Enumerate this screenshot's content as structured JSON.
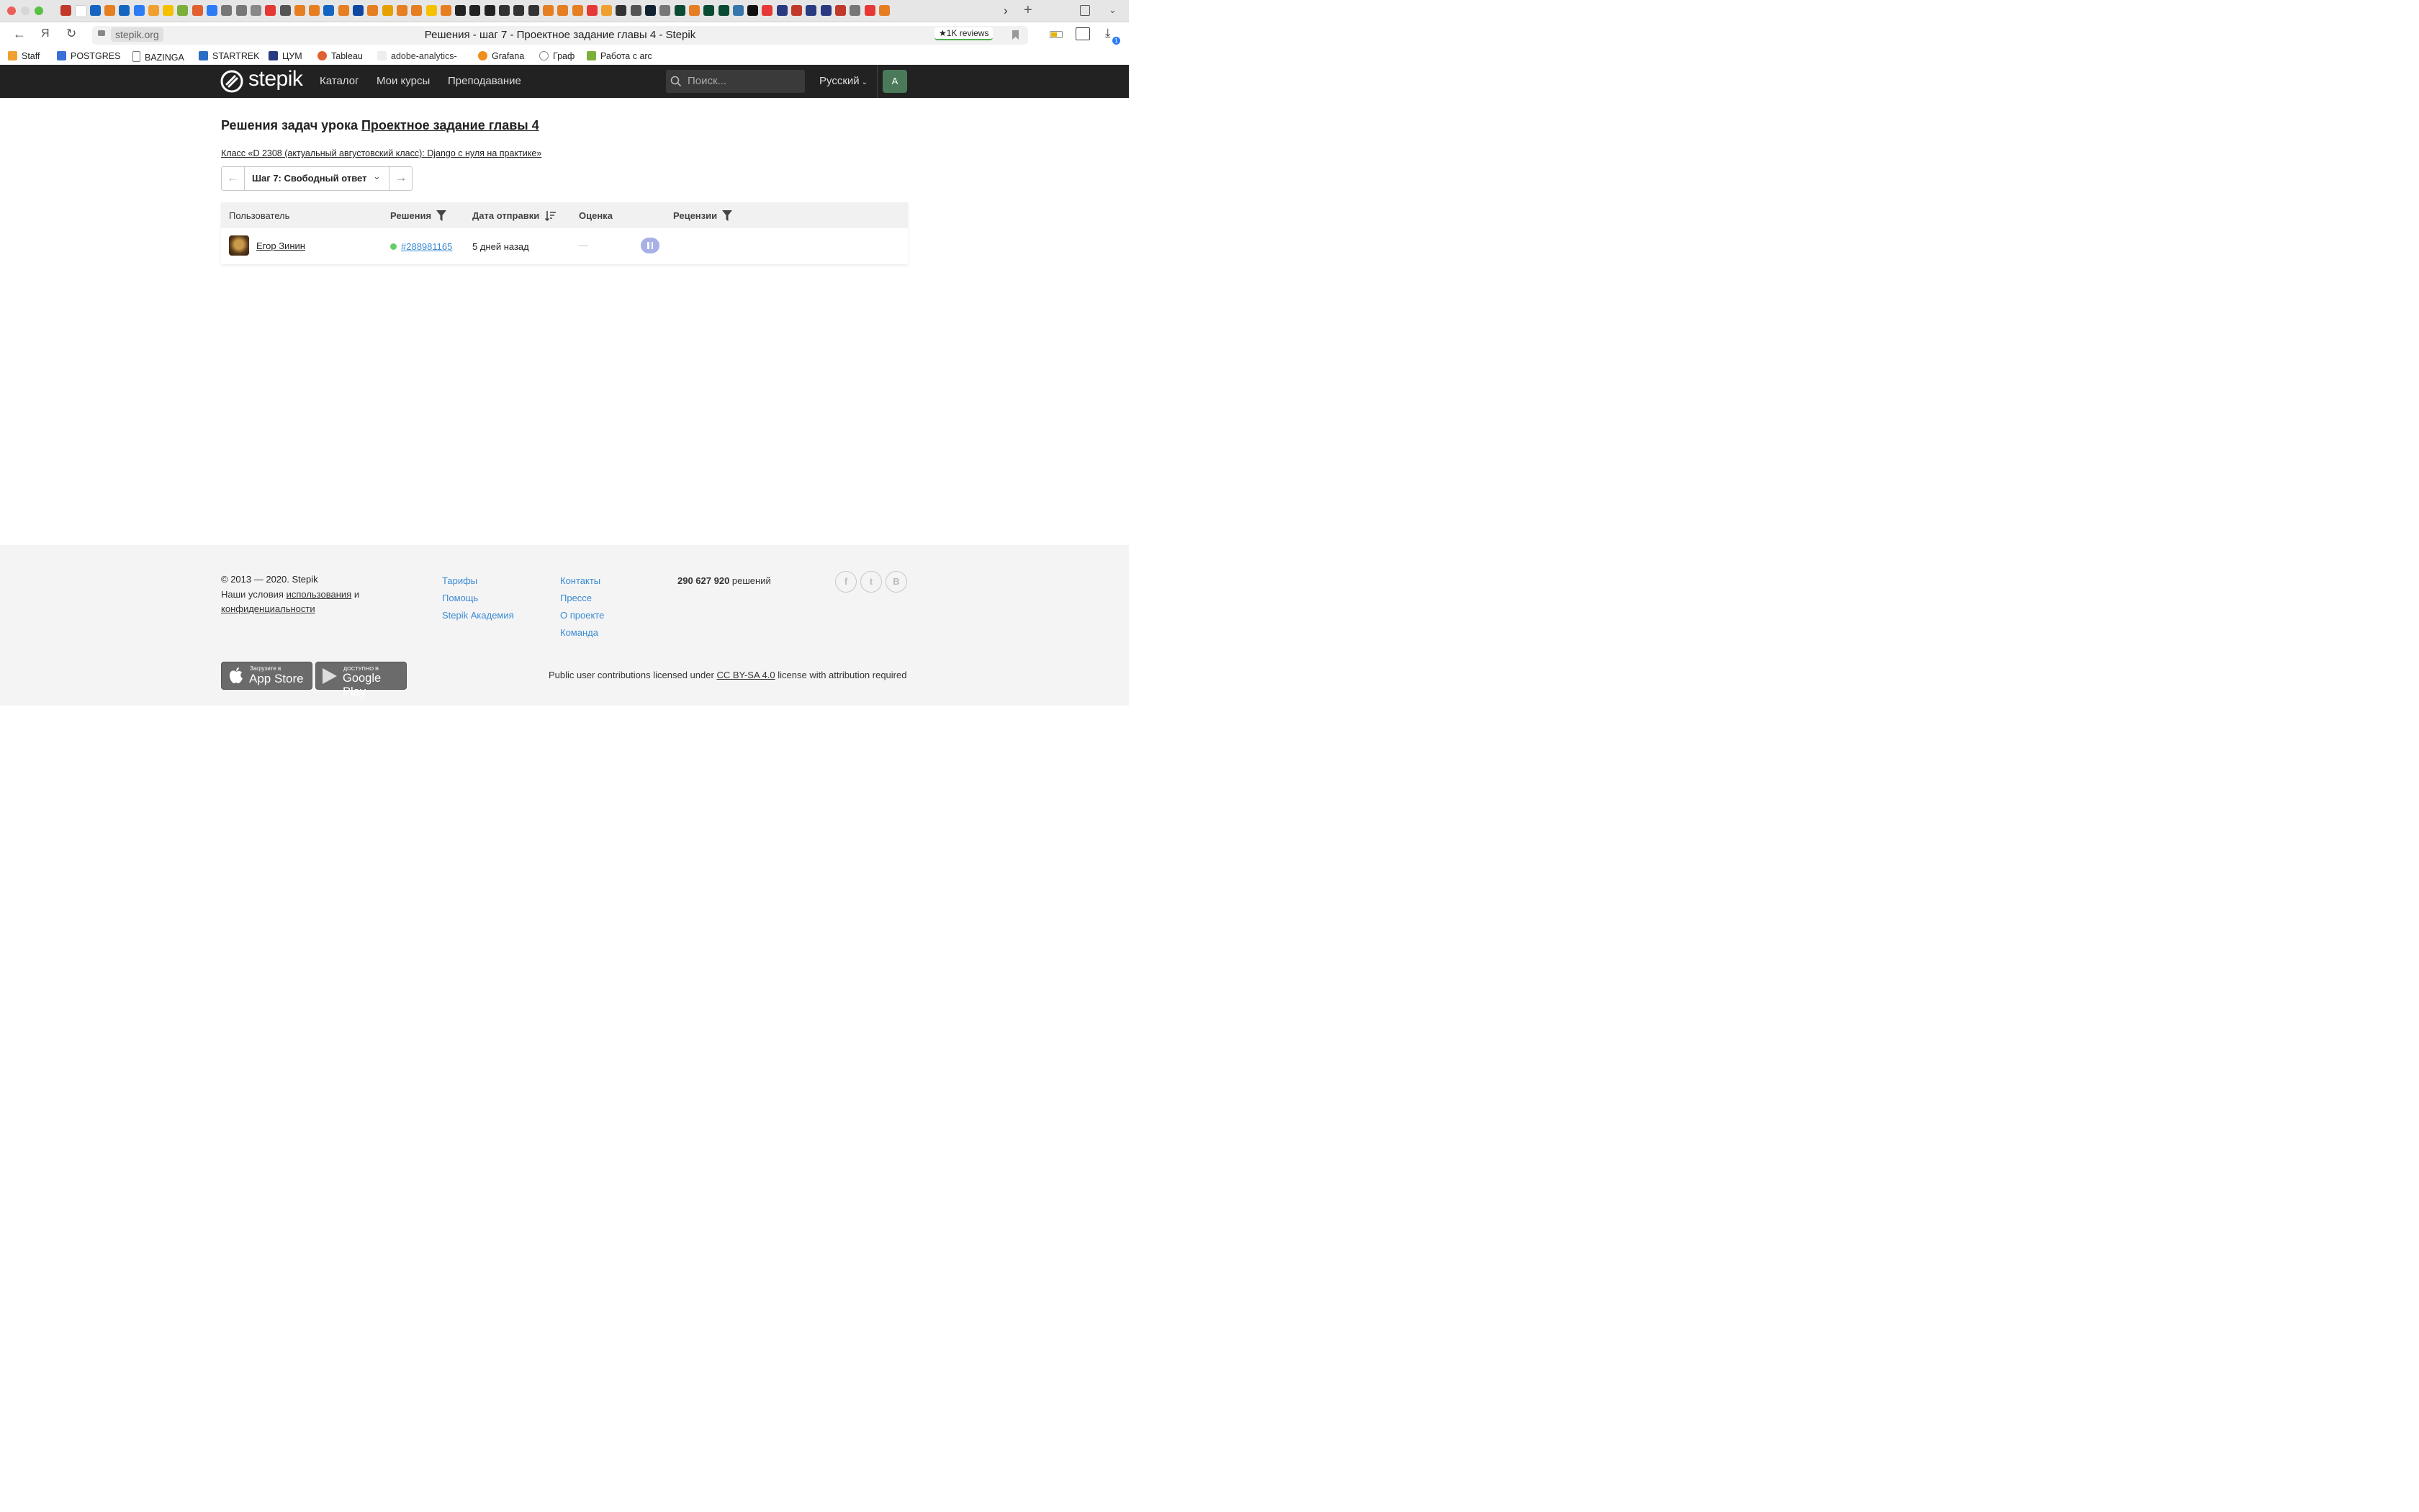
{
  "browser": {
    "page_title": "Решения - шаг 7 - Проектное задание главы 4 - Stepik",
    "url": "stepik.org",
    "reviews_badge": "★1K reviews",
    "download_count": "1",
    "bookmarks": [
      {
        "label": "Staff",
        "icon": "staff-icon"
      },
      {
        "label": "POSTGRES",
        "icon": "yc-icon"
      },
      {
        "label": "BAZINGA",
        "icon": "page-icon"
      },
      {
        "label": "STARTREK",
        "icon": "tracker-icon"
      },
      {
        "label": "ЦУМ",
        "icon": "cart-icon"
      },
      {
        "label": "Tableau",
        "icon": "tableau-icon"
      },
      {
        "label": "adobe-analytics-",
        "icon": "adobe-icon"
      },
      {
        "label": "Grafana",
        "icon": "grafana-icon"
      },
      {
        "label": "Граф",
        "icon": "graph-icon"
      },
      {
        "label": "Работа с arc",
        "icon": "w-icon"
      }
    ]
  },
  "header": {
    "logo_text": "stepik",
    "nav": [
      "Каталог",
      "Мои курсы",
      "Преподавание"
    ],
    "search_placeholder": "Поиск...",
    "language": "Русский",
    "avatar_letter": "А",
    "avatar_color": "#4a7a5a"
  },
  "main": {
    "title_prefix": "Решения задач урока",
    "lesson_link": "Проектное задание главы 4",
    "class_link": "Класс «D 2308 (актуальный августовский класс): Django с нуля на практике»",
    "step_select": "Шаг 7: Свободный ответ",
    "table": {
      "headers": {
        "user": "Пользователь",
        "solutions": "Решения",
        "date": "Дата отправки",
        "score": "Оценка",
        "reviews": "Рецензии"
      },
      "rows": [
        {
          "user": "Егор Зинин",
          "solution": "#288981165",
          "status_color": "#66cc66",
          "date": "5 дней назад",
          "score": "—"
        }
      ]
    }
  },
  "footer": {
    "copyright": "© 2013 — 2020. Stepik",
    "terms_prefix": "Наши условия",
    "terms_link": "использования",
    "terms_and": "и",
    "privacy_link": "конфиденциальности",
    "col1": [
      "Тарифы",
      "Помощь",
      "Stepik Академия"
    ],
    "col2": [
      "Контакты",
      "Прессе",
      "О проекте",
      "Команда"
    ],
    "solutions_count": "290 627 920",
    "solutions_word": "решений",
    "social": [
      "f",
      "t",
      "B"
    ],
    "appstore_small": "Загрузите в",
    "appstore_big": "App Store",
    "googleplay_small": "ДОСТУПНО В",
    "googleplay_big": "Google Play",
    "license_prefix": "Public user contributions licensed under",
    "license_link": "CC BY-SA 4.0",
    "license_suffix": "license with attribution required"
  }
}
